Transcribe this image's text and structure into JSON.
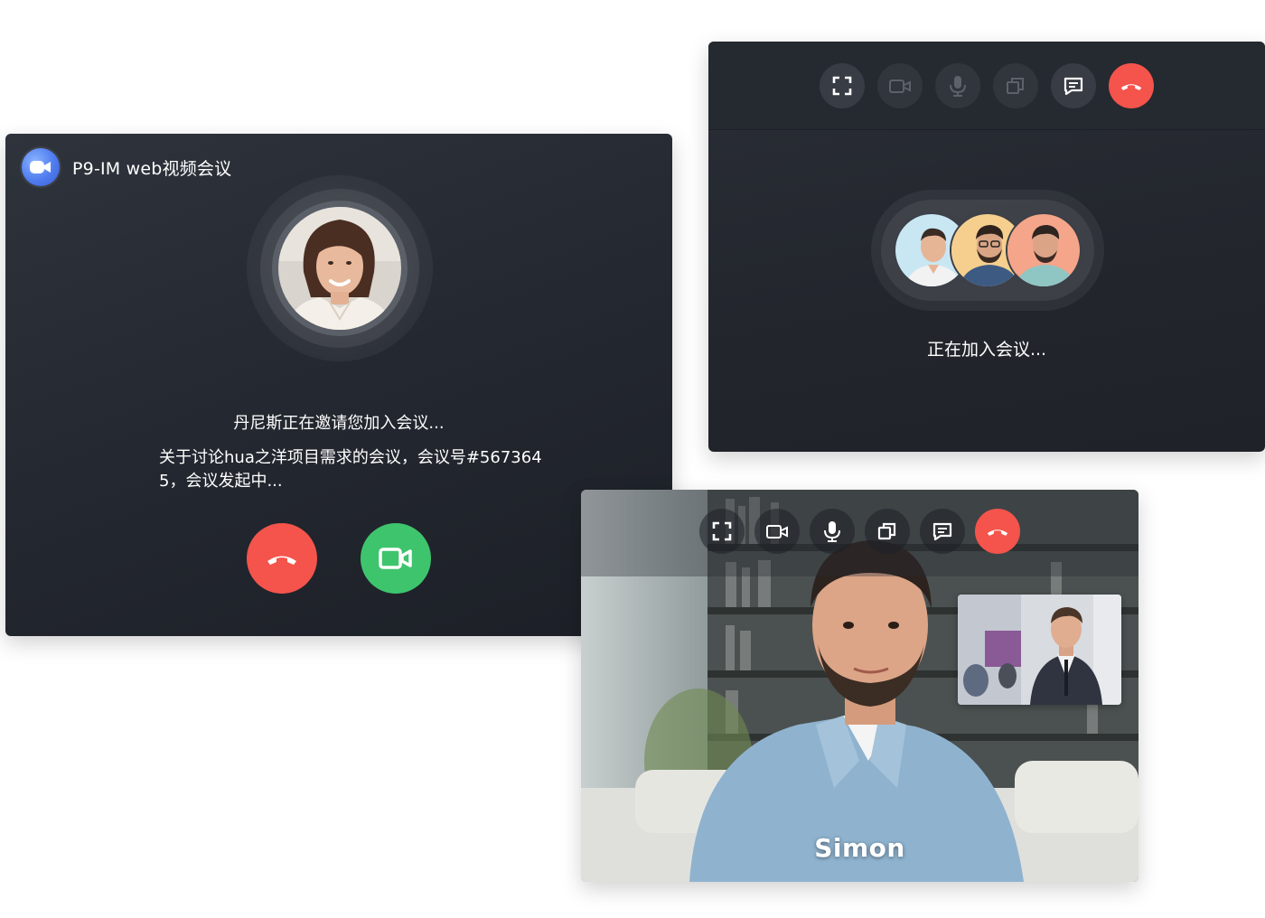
{
  "invite_panel": {
    "app_title": "P9-IM web视频会议",
    "invite_message": "丹尼斯正在邀请您加入会议...",
    "meeting_detail": "关于讨论hua之洋项目需求的会议，会议号#5673645，会议发起中..."
  },
  "joining_panel": {
    "status": "正在加入会议..."
  },
  "video_panel": {
    "speaker_name": "Simon"
  },
  "colors": {
    "panel_dark": "#23272f",
    "hangup_red": "#f4544b",
    "accept_green": "#3ec46d",
    "logo_blue": "#4f7cf0"
  },
  "icons": {
    "toolbar": [
      "fullscreen-icon",
      "camera-icon",
      "microphone-icon",
      "screen-share-icon",
      "chat-icon",
      "hang-up-icon"
    ],
    "invite": [
      "app-logo-icon",
      "hang-up-icon",
      "video-camera-icon"
    ]
  }
}
